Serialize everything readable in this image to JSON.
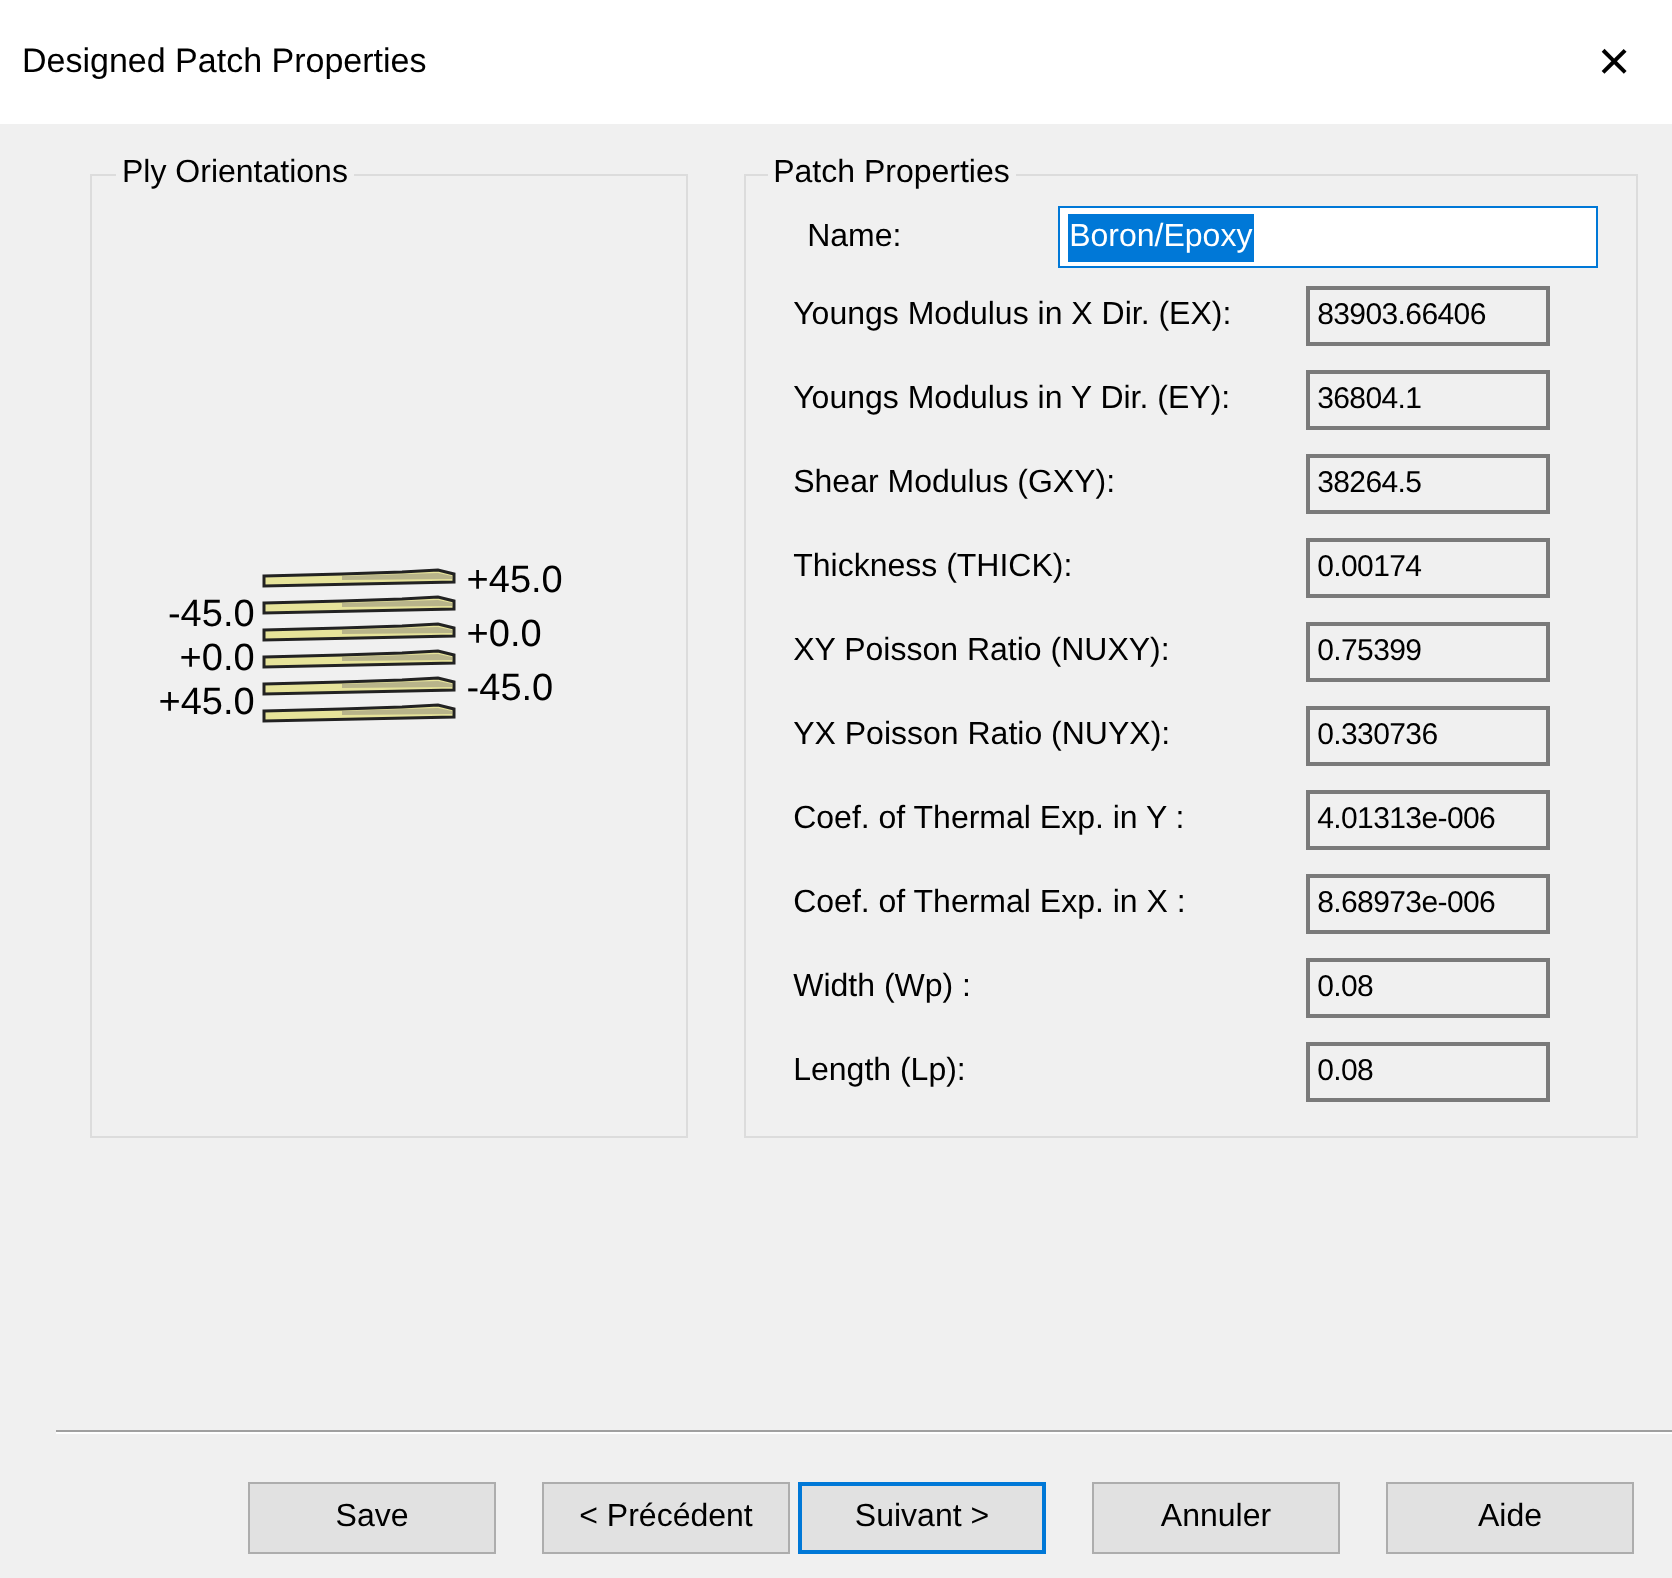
{
  "window": {
    "title": "Designed Patch Properties",
    "close": "×"
  },
  "ply_orientations": {
    "title": "Ply Orientations",
    "left_labels": [
      "-45.0",
      "+0.0",
      "+45.0"
    ],
    "right_labels": [
      "+45.0",
      "+0.0",
      "-45.0"
    ]
  },
  "patch_properties": {
    "title": "Patch Properties",
    "name": {
      "label": "Name:",
      "value": "Boron/Epoxy",
      "focused": true
    },
    "fields": [
      {
        "label": "Youngs Modulus in X Dir. (EX):",
        "value": "83903.66406"
      },
      {
        "label": "Youngs Modulus in Y Dir. (EY):",
        "value": "36804.1"
      },
      {
        "label": "Shear Modulus (GXY):",
        "value": "38264.5"
      },
      {
        "label": "Thickness (THICK):",
        "value": "0.00174"
      },
      {
        "label": "XY Poisson Ratio (NUXY):",
        "value": "0.75399"
      },
      {
        "label": "YX Poisson Ratio (NUYX):",
        "value": "0.330736"
      },
      {
        "label": "Coef. of Thermal Exp. in Y :",
        "value": "4.01313e-006"
      },
      {
        "label": "Coef. of Thermal Exp. in X :",
        "value": "8.68973e-006"
      },
      {
        "label": "Width (Wp) :",
        "value": "0.08"
      },
      {
        "label": "Length (Lp):",
        "value": "0.08"
      }
    ]
  },
  "buttons": [
    {
      "label": "Save",
      "default": false
    },
    {
      "label": "< Précédent",
      "default": false
    },
    {
      "label": "Suivant >",
      "default": true
    },
    {
      "label": "Annuler",
      "default": false
    },
    {
      "label": "Aide",
      "default": false
    }
  ]
}
